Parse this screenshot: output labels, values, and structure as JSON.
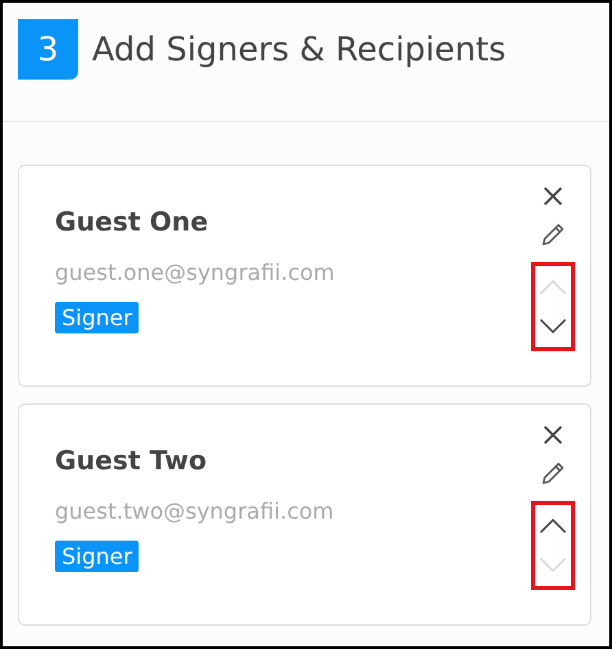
{
  "header": {
    "step": "3",
    "title": "Add Signers & Recipients"
  },
  "recipients": [
    {
      "name": "Guest One",
      "email": "guest.one@syngrafii.com",
      "role": "Signer",
      "move_up_disabled": true,
      "move_down_disabled": false,
      "highlighted": true
    },
    {
      "name": "Guest Two",
      "email": "guest.two@syngrafii.com",
      "role": "Signer",
      "move_up_disabled": false,
      "move_down_disabled": true,
      "highlighted": true
    }
  ]
}
